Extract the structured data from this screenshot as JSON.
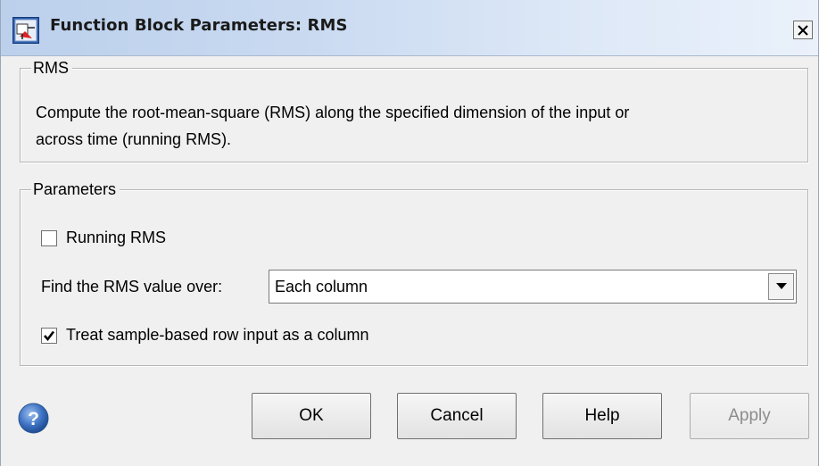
{
  "window": {
    "title": "Function Block Parameters: RMS",
    "icon": "simulink-block-icon",
    "close_glyph": "✕"
  },
  "rms_group": {
    "legend": "RMS",
    "description_line1": "Compute the root-mean-square (RMS) along the specified dimension of the input or",
    "description_line2": "across time (running RMS)."
  },
  "parameters_group": {
    "legend": "Parameters",
    "running_rms": {
      "label": "Running RMS",
      "checked": false
    },
    "find_over": {
      "label": "Find the RMS value over:",
      "value": "Each column"
    },
    "treat_row": {
      "label": "Treat sample-based row input as a column",
      "checked": true
    }
  },
  "buttons": {
    "help_icon": "question-icon",
    "ok": "OK",
    "cancel": "Cancel",
    "help": "Help",
    "apply": "Apply"
  },
  "colors": {
    "titlebar_start": "#bcd0ec",
    "titlebar_end": "#eaf1fb",
    "help_icon_blue": "#3f73c4"
  }
}
